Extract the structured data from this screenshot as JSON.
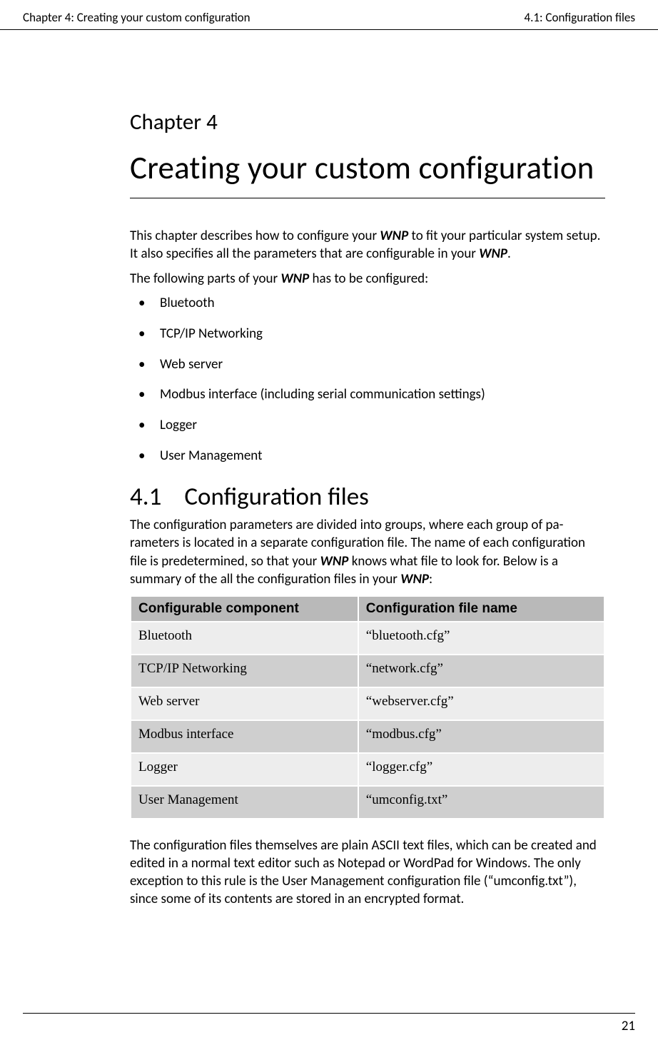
{
  "header": {
    "left": "Chapter 4: Creating your custom configuration",
    "right": "4.1: Configuration files"
  },
  "chapter": {
    "label": "Chapter 4",
    "title": "Creating your custom configuration"
  },
  "intro": {
    "para1_a": "This chapter describes how to configure your ",
    "para1_b": " to fit your particular system setup. It also specifies all the parameters that are configurable in your ",
    "para1_c": ".",
    "para2_a": "The following parts of your ",
    "para2_b": " has to be configured:",
    "wnp": "WNP"
  },
  "bullets": [
    "Bluetooth",
    "TCP/IP Networking",
    "Web server",
    "Modbus interface (including serial communication settings)",
    "Logger",
    "User Management"
  ],
  "section": {
    "number": "4.1",
    "title": "Configuration files",
    "para_a": "The configuration parameters are divided into groups, where each group of pa­rameters is located in a separate configuration file. The name of each configura­tion file is predetermined, so that your ",
    "para_b": " knows what file to look for. Below is a summary of the all the configuration files in your ",
    "para_c": ":"
  },
  "table": {
    "headers": [
      "Configurable component",
      "Configuration file name"
    ],
    "rows": [
      {
        "component": "Bluetooth",
        "file": "“bluetooth.cfg”"
      },
      {
        "component": "TCP/IP Networking",
        "file": "“network.cfg”"
      },
      {
        "component": "Web server",
        "file": "“webserver.cfg”"
      },
      {
        "component": "Modbus interface",
        "file": "“modbus.cfg”"
      },
      {
        "component": "Logger",
        "file": "“logger.cfg”"
      },
      {
        "component": "User Management",
        "file": "“umconfig.txt”"
      }
    ]
  },
  "closing": "The configuration files themselves are plain ASCII text files, which can be created and edited in a normal text editor such as Notepad or WordPad for Windows. The only exception to this rule is the User Management configuration file (“umcon­fig.txt”), since some of its contents are stored in an encrypted format.",
  "footer": {
    "page": "21"
  }
}
